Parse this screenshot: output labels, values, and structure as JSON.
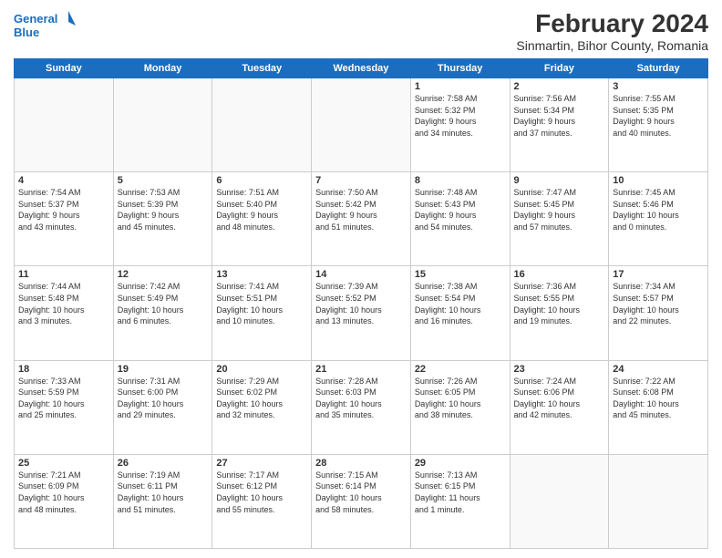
{
  "header": {
    "logo_line1": "General",
    "logo_line2": "Blue",
    "title": "February 2024",
    "subtitle": "Sinmartin, Bihor County, Romania"
  },
  "weekdays": [
    "Sunday",
    "Monday",
    "Tuesday",
    "Wednesday",
    "Thursday",
    "Friday",
    "Saturday"
  ],
  "weeks": [
    [
      {
        "day": "",
        "info": ""
      },
      {
        "day": "",
        "info": ""
      },
      {
        "day": "",
        "info": ""
      },
      {
        "day": "",
        "info": ""
      },
      {
        "day": "1",
        "info": "Sunrise: 7:58 AM\nSunset: 5:32 PM\nDaylight: 9 hours\nand 34 minutes."
      },
      {
        "day": "2",
        "info": "Sunrise: 7:56 AM\nSunset: 5:34 PM\nDaylight: 9 hours\nand 37 minutes."
      },
      {
        "day": "3",
        "info": "Sunrise: 7:55 AM\nSunset: 5:35 PM\nDaylight: 9 hours\nand 40 minutes."
      }
    ],
    [
      {
        "day": "4",
        "info": "Sunrise: 7:54 AM\nSunset: 5:37 PM\nDaylight: 9 hours\nand 43 minutes."
      },
      {
        "day": "5",
        "info": "Sunrise: 7:53 AM\nSunset: 5:39 PM\nDaylight: 9 hours\nand 45 minutes."
      },
      {
        "day": "6",
        "info": "Sunrise: 7:51 AM\nSunset: 5:40 PM\nDaylight: 9 hours\nand 48 minutes."
      },
      {
        "day": "7",
        "info": "Sunrise: 7:50 AM\nSunset: 5:42 PM\nDaylight: 9 hours\nand 51 minutes."
      },
      {
        "day": "8",
        "info": "Sunrise: 7:48 AM\nSunset: 5:43 PM\nDaylight: 9 hours\nand 54 minutes."
      },
      {
        "day": "9",
        "info": "Sunrise: 7:47 AM\nSunset: 5:45 PM\nDaylight: 9 hours\nand 57 minutes."
      },
      {
        "day": "10",
        "info": "Sunrise: 7:45 AM\nSunset: 5:46 PM\nDaylight: 10 hours\nand 0 minutes."
      }
    ],
    [
      {
        "day": "11",
        "info": "Sunrise: 7:44 AM\nSunset: 5:48 PM\nDaylight: 10 hours\nand 3 minutes."
      },
      {
        "day": "12",
        "info": "Sunrise: 7:42 AM\nSunset: 5:49 PM\nDaylight: 10 hours\nand 6 minutes."
      },
      {
        "day": "13",
        "info": "Sunrise: 7:41 AM\nSunset: 5:51 PM\nDaylight: 10 hours\nand 10 minutes."
      },
      {
        "day": "14",
        "info": "Sunrise: 7:39 AM\nSunset: 5:52 PM\nDaylight: 10 hours\nand 13 minutes."
      },
      {
        "day": "15",
        "info": "Sunrise: 7:38 AM\nSunset: 5:54 PM\nDaylight: 10 hours\nand 16 minutes."
      },
      {
        "day": "16",
        "info": "Sunrise: 7:36 AM\nSunset: 5:55 PM\nDaylight: 10 hours\nand 19 minutes."
      },
      {
        "day": "17",
        "info": "Sunrise: 7:34 AM\nSunset: 5:57 PM\nDaylight: 10 hours\nand 22 minutes."
      }
    ],
    [
      {
        "day": "18",
        "info": "Sunrise: 7:33 AM\nSunset: 5:59 PM\nDaylight: 10 hours\nand 25 minutes."
      },
      {
        "day": "19",
        "info": "Sunrise: 7:31 AM\nSunset: 6:00 PM\nDaylight: 10 hours\nand 29 minutes."
      },
      {
        "day": "20",
        "info": "Sunrise: 7:29 AM\nSunset: 6:02 PM\nDaylight: 10 hours\nand 32 minutes."
      },
      {
        "day": "21",
        "info": "Sunrise: 7:28 AM\nSunset: 6:03 PM\nDaylight: 10 hours\nand 35 minutes."
      },
      {
        "day": "22",
        "info": "Sunrise: 7:26 AM\nSunset: 6:05 PM\nDaylight: 10 hours\nand 38 minutes."
      },
      {
        "day": "23",
        "info": "Sunrise: 7:24 AM\nSunset: 6:06 PM\nDaylight: 10 hours\nand 42 minutes."
      },
      {
        "day": "24",
        "info": "Sunrise: 7:22 AM\nSunset: 6:08 PM\nDaylight: 10 hours\nand 45 minutes."
      }
    ],
    [
      {
        "day": "25",
        "info": "Sunrise: 7:21 AM\nSunset: 6:09 PM\nDaylight: 10 hours\nand 48 minutes."
      },
      {
        "day": "26",
        "info": "Sunrise: 7:19 AM\nSunset: 6:11 PM\nDaylight: 10 hours\nand 51 minutes."
      },
      {
        "day": "27",
        "info": "Sunrise: 7:17 AM\nSunset: 6:12 PM\nDaylight: 10 hours\nand 55 minutes."
      },
      {
        "day": "28",
        "info": "Sunrise: 7:15 AM\nSunset: 6:14 PM\nDaylight: 10 hours\nand 58 minutes."
      },
      {
        "day": "29",
        "info": "Sunrise: 7:13 AM\nSunset: 6:15 PM\nDaylight: 11 hours\nand 1 minute."
      },
      {
        "day": "",
        "info": ""
      },
      {
        "day": "",
        "info": ""
      }
    ]
  ]
}
